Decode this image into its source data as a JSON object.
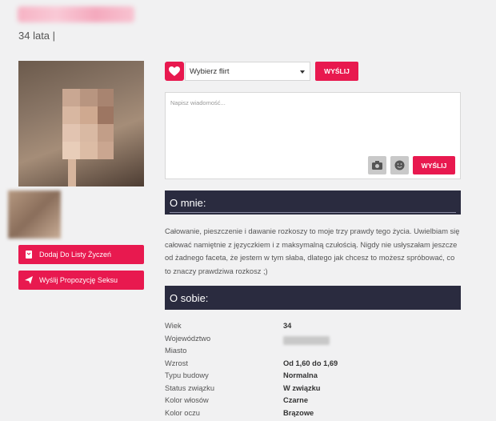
{
  "profile": {
    "age_label": "34 lata |"
  },
  "sidebar": {
    "wishlist_label": "Dodaj Do Listy Życzeń",
    "proposal_label": "Wyślij Propozycję Seksu"
  },
  "flirt": {
    "select_value": "Wybierz flirt",
    "send_label": "WYŚLIJ"
  },
  "message": {
    "placeholder": "Napisz wiadomość...",
    "send_label": "WYŚLIJ"
  },
  "about": {
    "heading": "O mnie:",
    "text": "Całowanie, pieszczenie i dawanie rozkoszy to moje trzy prawdy tego życia. Uwielbiam się całować namiętnie z języczkiem i z maksymalną czułością. Nigdy nie usłyszałam jeszcze od żadnego faceta, że jestem w tym słaba, dlatego jak chcesz to możesz spróbować, co to znaczy prawdziwa rozkosz ;)"
  },
  "details": {
    "heading": "O sobie:",
    "rows": [
      {
        "label": "Wiek",
        "value": "34"
      },
      {
        "label": "Województwo",
        "value": ""
      },
      {
        "label": "Miasto",
        "value": ""
      },
      {
        "label": "Wzrost",
        "value": "Od 1,60 do 1,69"
      },
      {
        "label": "Typu budowy",
        "value": "Normalna"
      },
      {
        "label": "Status związku",
        "value": "W związku"
      },
      {
        "label": "Kolor włosów",
        "value": "Czarne"
      },
      {
        "label": "Kolor oczu",
        "value": "Brązowe"
      }
    ]
  },
  "colors": {
    "accent": "#e8194f",
    "header_dark": "#2a2b3f"
  }
}
